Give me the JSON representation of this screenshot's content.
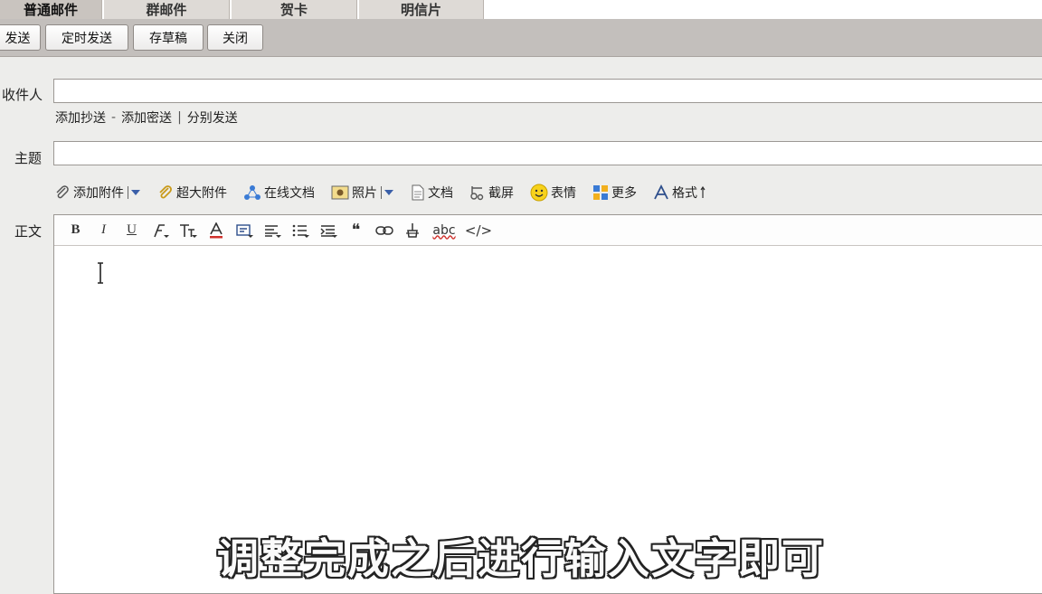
{
  "tabs": [
    {
      "label": "普通邮件"
    },
    {
      "label": "群邮件"
    },
    {
      "label": "贺卡"
    },
    {
      "label": "明信片"
    }
  ],
  "toolbar": {
    "send_label": "发送",
    "scheduled_label": "定时发送",
    "draft_label": "存草稿",
    "close_label": "关闭"
  },
  "form": {
    "to_label": "收件人",
    "to_value": "",
    "add_cc": "添加抄送",
    "dash": "-",
    "add_bcc": "添加密送",
    "pipe": "|",
    "separate_send": "分别发送",
    "subject_label": "主题",
    "subject_value": "",
    "body_label": "正文"
  },
  "attach": {
    "add_attachment": "添加附件",
    "large_attachment": "超大附件",
    "online_doc": "在线文档",
    "photo": "照片",
    "document": "文档",
    "screenshot": "截屏",
    "emoji": "表情",
    "more": "更多",
    "format": "格式"
  },
  "format": {
    "bold": "B",
    "italic": "I",
    "underline": "U",
    "quote": "❝",
    "spell": "abc",
    "code": "</>"
  },
  "overlay": {
    "subtitle": "调整完成之后进行输入文字即可"
  }
}
